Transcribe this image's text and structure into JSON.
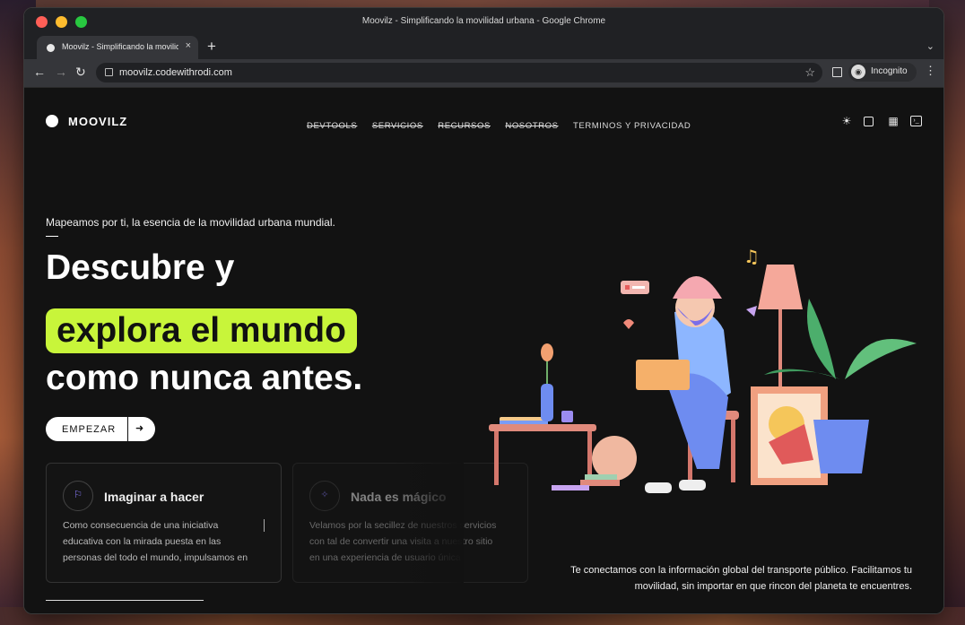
{
  "window": {
    "title": "Moovilz - Simplificando la movilidad urbana - Google Chrome"
  },
  "tab": {
    "title": "Moovilz - Simplificando la movilidad urbana",
    "close": "×",
    "new_tab": "+",
    "menu": "⌄"
  },
  "toolbar": {
    "back": "←",
    "forward": "→",
    "reload": "↻",
    "url": "moovilz.codewithrodi.com",
    "bookmark": "☆",
    "incognito_label": "Incognito",
    "menu": "⋮"
  },
  "site": {
    "brand": "MOOVILZ",
    "nav": [
      {
        "label": "DEVTOOLS",
        "struck": true
      },
      {
        "label": "SERVICIOS",
        "struck": true
      },
      {
        "label": "RECURSOS",
        "struck": true
      },
      {
        "label": "NOSOTROS",
        "struck": true
      },
      {
        "label": "TERMINOS Y PRIVACIDAD",
        "struck": false
      }
    ],
    "header_icons": [
      "sun-icon",
      "square-icon",
      "qr-icon",
      "terminal-icon"
    ]
  },
  "hero": {
    "subtitle": "Mapeamos por ti, la esencia de la movilidad urbana mundial.",
    "line1": "Descubre y",
    "line2": "explora el mundo",
    "line3": "como nunca antes.",
    "cta_label": "EMPEZAR",
    "cta_arrow": "➜",
    "accent_color": "#c8f53a"
  },
  "cards": [
    {
      "icon": "flag-icon",
      "title": "Imaginar a hacer",
      "body": "Como consecuencia de una iniciativa educativa con la mirada puesta en las personas del todo el mundo, impulsamos en"
    },
    {
      "icon": "magic-wand-icon",
      "title": "Nada es mágico",
      "body": "Velamos por la secillez de nuestros servicios con tal de convertir una visita a nuestro sitio en una experiencia de usuario única"
    }
  ],
  "tagline": "Te conectamos con la información global del transporte público. Facilitamos tu movilidad, sin importar en que rincon del planeta te encuentres."
}
